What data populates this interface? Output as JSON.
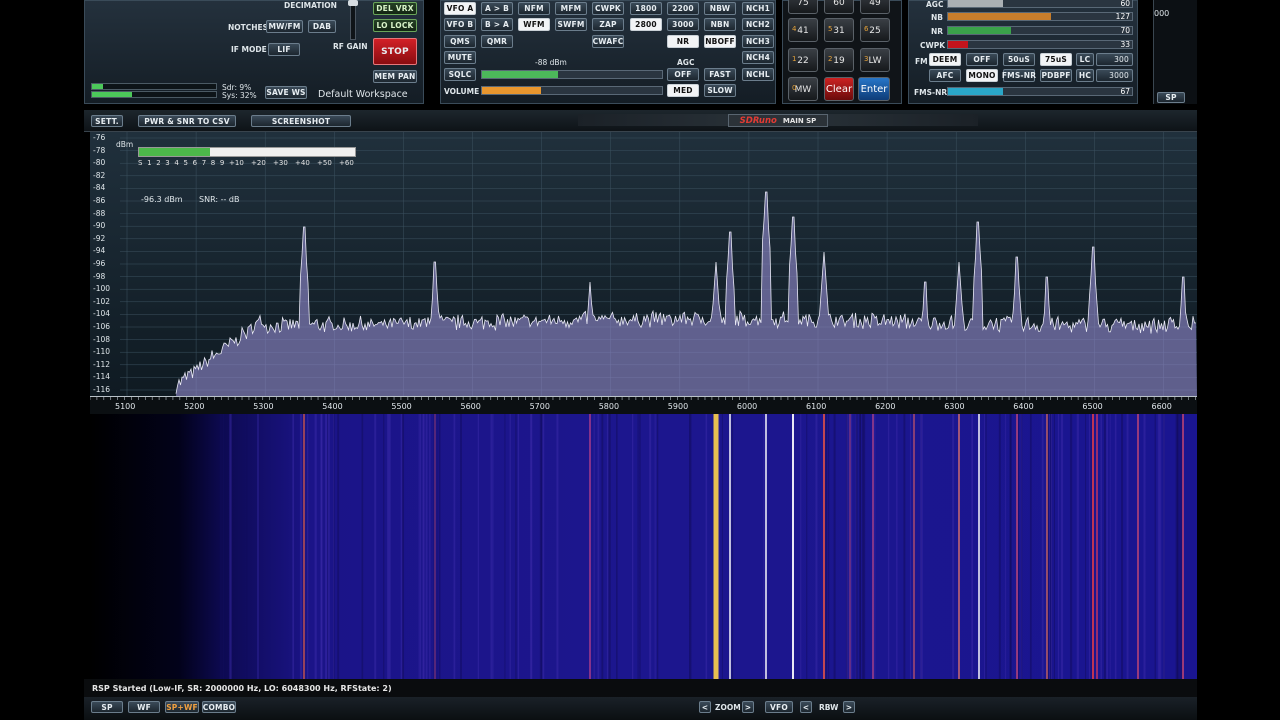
{
  "top_left": {
    "decimation_label": "DECIMATION",
    "del_vrx": "DEL VRX",
    "lo_lock": "LO LOCK",
    "notches_label": "NOTCHES",
    "mwfm": "MW/FM",
    "dab": "DAB",
    "if_mode_label": "IF MODE",
    "lif": "LIF",
    "rf_gain_label": "RF GAIN",
    "stop": "STOP",
    "mem_pan": "MEM PAN",
    "sdr_pct": "Sdr: 9%",
    "sys_pct": "Sys: 32%",
    "save_ws": "SAVE WS",
    "workspace": "Default Workspace",
    "sdr_level": 0.09,
    "sys_level": 0.32
  },
  "mode_panel": {
    "vfo_a": "VFO A",
    "a_to_b": "A > B",
    "nfm": "NFM",
    "mfm": "MFM",
    "cwpk": "CWPK",
    "f1800": "1800",
    "f2200": "2200",
    "nbw": "NBW",
    "nch1": "NCH1",
    "vfo_b": "VFO B",
    "b_to_a": "B > A",
    "wfm": "WFM",
    "swfm": "SWFM",
    "zap": "ZAP",
    "f2800": "2800",
    "f3000": "3000",
    "nbn": "NBN",
    "nch2": "NCH2",
    "qms": "QMS",
    "qmr": "QMR",
    "cwafc": "CWAFC",
    "nr": "NR",
    "nboff": "NBOFF",
    "nch3": "NCH3",
    "mute": "MUTE",
    "dbm": "-88 dBm",
    "agc": "AGC",
    "nch4": "NCH4",
    "sqlc": "SQLC",
    "off": "OFF",
    "fast": "FAST",
    "nchl": "NCHL",
    "volume": "VOLUME",
    "med": "MED",
    "slow": "SLOW",
    "sql_level": 0.42,
    "volume_level": 0.33
  },
  "keypad": {
    "row0": [
      "75",
      "60",
      "49"
    ],
    "row1": [
      {
        "sub": "4",
        "main": "41"
      },
      {
        "sub": "5",
        "main": "31"
      },
      {
        "sub": "6",
        "main": "25"
      }
    ],
    "row2": [
      {
        "sub": "1",
        "main": "22"
      },
      {
        "sub": "2",
        "main": "19"
      },
      {
        "sub": "3",
        "main": "LW"
      }
    ],
    "row3": [
      {
        "sub": "0",
        "main": "MW"
      },
      {
        "sub": "",
        "main": "Clear"
      },
      {
        "sub": "",
        "main": "Enter"
      }
    ]
  },
  "right_panel": {
    "agc": {
      "label": "AGC",
      "value": "60"
    },
    "nb": {
      "label": "NB",
      "value": "127"
    },
    "nr": {
      "label": "NR",
      "value": "70"
    },
    "cwpk": {
      "label": "CWPK",
      "value": "33"
    },
    "fm_label": "FM",
    "deem": "DEEM",
    "off": "OFF",
    "us50": "50uS",
    "us75": "75uS",
    "lc": "LC",
    "lc_val": "300",
    "afc": "AFC",
    "mono": "MONO",
    "fmsnr": "FMS-NR",
    "pdbpf": "PDBPF",
    "hc": "HC",
    "hc_val": "3000",
    "fmsnr_bar": {
      "label": "FMS-NR",
      "value": "67"
    },
    "far_right_value": "000",
    "sp": "SP",
    "agc_level": 0.3,
    "nb_level": 0.56,
    "nr_level": 0.34,
    "cwpk_level": 0.11,
    "fmsnr_level": 0.3
  },
  "toolbar": {
    "sett": "SETT.",
    "pwr_csv": "PWR & SNR TO CSV",
    "screenshot": "SCREENSHOT",
    "brand": "SDRuno",
    "main_sp": "MAIN SP"
  },
  "spectrum": {
    "dbm_unit": "dBm",
    "smeter_labels": [
      "S",
      "1",
      "2",
      "3",
      "4",
      "5",
      "6",
      "7",
      "8",
      "9",
      "+10",
      "+20",
      "+30",
      "+40",
      "+50",
      "+60"
    ],
    "smeter_level": 0.33,
    "readout": "-96.3 dBm",
    "snr": "SNR: -- dB",
    "y_labels": [
      "-76",
      "-78",
      "-80",
      "-82",
      "-84",
      "-86",
      "-88",
      "-90",
      "-92",
      "-94",
      "-96",
      "-98",
      "-100",
      "-102",
      "-104",
      "-106",
      "-108",
      "-110",
      "-112",
      "-114",
      "-116"
    ],
    "x_labels": [
      "5100",
      "5200",
      "5300",
      "5400",
      "5500",
      "5600",
      "5700",
      "5800",
      "5900",
      "6000",
      "6100",
      "6200",
      "6300",
      "6400",
      "6500",
      "6600"
    ]
  },
  "status": "RSP Started (Low-IF, SR: 2000000 Hz, LO: 6048300 Hz, RFState: 2)",
  "bottom": {
    "sp": "SP",
    "wf": "WF",
    "spwf": "SP+WF",
    "combo": "COMBO",
    "zoom": "ZOOM",
    "vfo": "VFO",
    "rbw": "RBW",
    "prev": "<",
    "next": ">"
  },
  "colors": {
    "spectrum_fill": "#8a84c4",
    "waterfall_bg": "#1c168e",
    "stop_red": "#c0141b",
    "accent_orange": "#e8962e",
    "accent_green": "#4cb85a"
  }
}
